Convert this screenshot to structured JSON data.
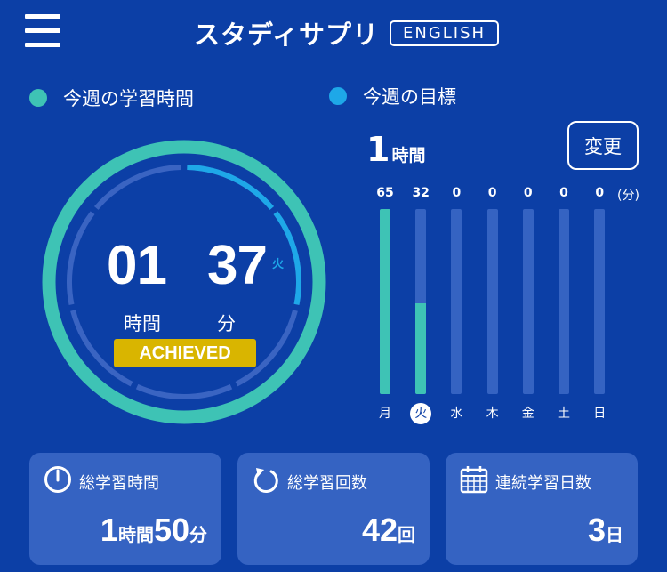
{
  "header": {
    "logo_text": "スタディサプリ",
    "logo_badge": "ENGLISH"
  },
  "legend": {
    "this_week": "今週の学習時間",
    "goal": "今週の目標"
  },
  "goal": {
    "value": "1",
    "unit": "時間",
    "change_label": "変更"
  },
  "colors": {
    "background": "#0c3fa6",
    "study_teal": "#3ec3b5",
    "goal_blue": "#1ea8e8",
    "track": "#3563c2",
    "achieved": "#d9b500"
  },
  "ring": {
    "hours": "01",
    "minutes": "37",
    "hours_label": "時間",
    "minutes_label": "分",
    "today_mark": "火",
    "status": "ACHIEVED",
    "progress_percent": 100,
    "today_fraction": 0.27
  },
  "chart_data": {
    "type": "bar",
    "categories": [
      "月",
      "火",
      "水",
      "木",
      "金",
      "土",
      "日"
    ],
    "values": [
      65,
      32,
      0,
      0,
      0,
      0,
      0
    ],
    "value_labels": [
      "65",
      "32",
      "0",
      "0",
      "0",
      "0",
      "0"
    ],
    "unit": "(分)",
    "today": "火",
    "ylim": [
      0,
      65
    ]
  },
  "cards": [
    {
      "title": "総学習時間",
      "icon": "clock-icon",
      "parts": [
        [
          "1",
          "時間"
        ],
        [
          "50",
          "分"
        ]
      ]
    },
    {
      "title": "総学習回数",
      "icon": "refresh-icon",
      "parts": [
        [
          "42",
          "回"
        ]
      ]
    },
    {
      "title": "連続学習日数",
      "icon": "calendar-icon",
      "parts": [
        [
          "3",
          "日"
        ]
      ]
    }
  ]
}
